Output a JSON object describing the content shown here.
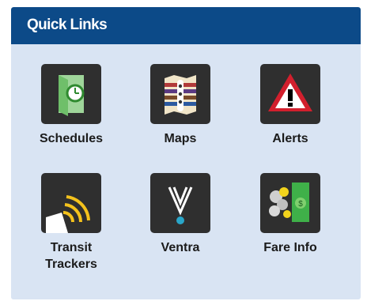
{
  "widget": {
    "title": "Quick Links",
    "colors": {
      "header": "#0c4a88",
      "panel": "#d9e4f3",
      "tile": "#2f2f2f"
    }
  },
  "links": [
    {
      "label": "Schedules",
      "icon": "schedule-clock-icon"
    },
    {
      "label": "Maps",
      "icon": "folded-map-icon"
    },
    {
      "label": "Alerts",
      "icon": "warning-triangle-icon"
    },
    {
      "label_line1": "Transit",
      "label_line2": "Trackers",
      "icon": "signal-waves-icon"
    },
    {
      "label": "Ventra",
      "icon": "ventra-v-icon"
    },
    {
      "label": "Fare Info",
      "icon": "fare-card-coins-icon"
    }
  ]
}
